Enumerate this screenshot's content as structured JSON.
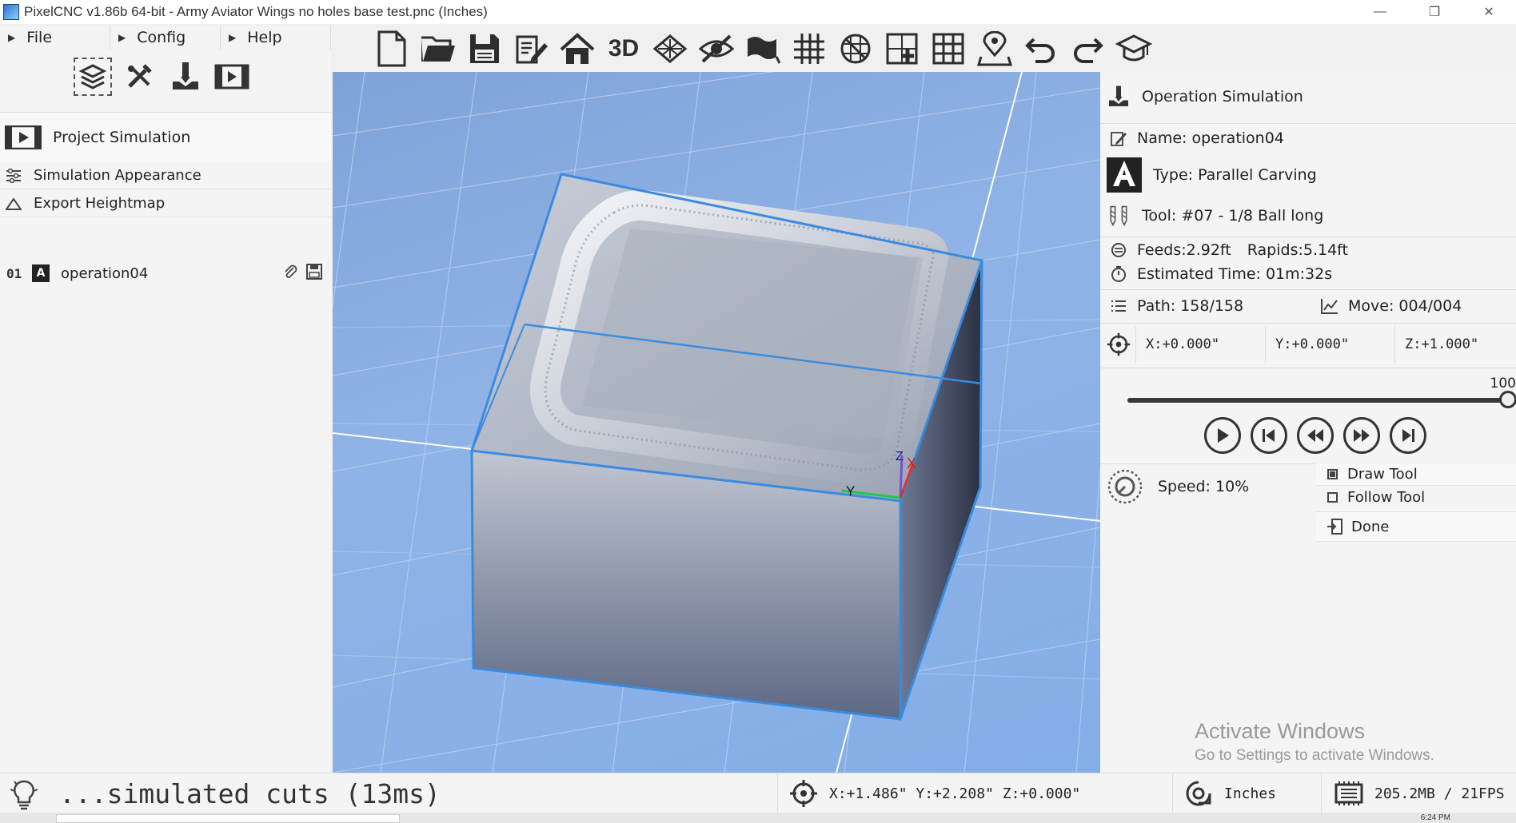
{
  "window": {
    "title": "PixelCNC v1.86b 64-bit  - Army Aviator Wings no holes base test.pnc (Inches)",
    "minimize": "—",
    "restore": "❐",
    "close": "✕"
  },
  "menu": [
    {
      "label": "File"
    },
    {
      "label": "Config"
    },
    {
      "label": "Help"
    }
  ],
  "left_panel": {
    "modes": [
      "layers-mode-icon",
      "tools-mode-icon",
      "operations-mode-icon",
      "simulation-mode-icon"
    ],
    "header": "Project Simulation",
    "rows": [
      {
        "label": "Simulation Appearance",
        "icon": "sliders-icon"
      },
      {
        "label": "Export Heightmap",
        "icon": "mountain-icon"
      }
    ],
    "operation": {
      "num": "01",
      "glyph": "A",
      "name": "operation04"
    }
  },
  "toolbar": {
    "three_d_label": "3D",
    "icons": [
      "new-file-icon",
      "open-folder-icon",
      "save-icon",
      "edit-icon",
      "home-view-icon",
      "3d-view-icon",
      "layers-view-icon",
      "hide-icon",
      "flag-icon",
      "grid-icon",
      "snap-off-icon",
      "add-region-icon",
      "table-icon",
      "map-pin-icon",
      "undo-icon",
      "redo-icon",
      "tutorial-icon"
    ]
  },
  "viewport": {
    "axis_x": "X",
    "axis_y": "Y",
    "axis_z": "Z"
  },
  "right_panel": {
    "header": "Operation Simulation",
    "name": "Name: operation04",
    "type": "Type: Parallel Carving",
    "tool": "Tool: #07 - 1/8 Ball long",
    "feeds": "Feeds:2.92ft",
    "rapids": "Rapids:5.14ft",
    "time": "Estimated Time: 01m:32s",
    "path": "Path: 158/158",
    "move": "Move: 004/004",
    "coords": {
      "x": "X:+0.000\"",
      "y": "Y:+0.000\"",
      "z": "Z:+1.000\""
    },
    "slider": {
      "label": "100",
      "value": 1.0
    },
    "speed": "Speed:  10%",
    "draw_tool": "Draw Tool",
    "follow_tool": "Follow Tool",
    "done": "Done"
  },
  "watermark": {
    "line1": "Activate Windows",
    "line2": "Go to Settings to activate Windows."
  },
  "status": {
    "message": "...simulated cuts (13ms)",
    "cursor": "X:+1.486\" Y:+2.208\" Z:+0.000\"",
    "units": "Inches",
    "memory": "205.2MB / 21FPS"
  },
  "taskbar": {
    "clock": "6:24 PM"
  },
  "colors": {
    "accent": "#3a8be0",
    "viewport_bg": "#86ace4",
    "panel_bg": "#f4f4f4"
  }
}
